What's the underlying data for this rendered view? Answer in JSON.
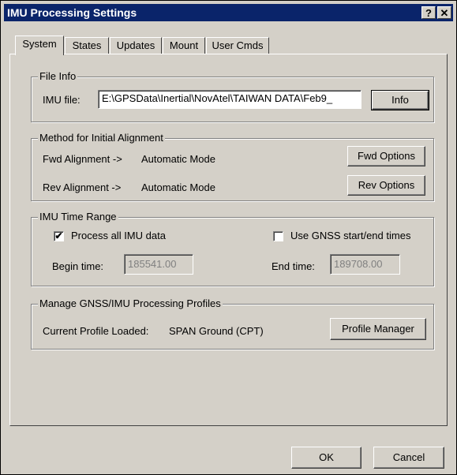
{
  "window": {
    "title": "IMU Processing Settings",
    "help_label": "?",
    "close_label": "✕"
  },
  "tabs": [
    {
      "label": "System",
      "active": true
    },
    {
      "label": "States"
    },
    {
      "label": "Updates"
    },
    {
      "label": "Mount"
    },
    {
      "label": "User Cmds"
    }
  ],
  "file_info": {
    "group_title": "File Info",
    "imu_label": "IMU file:",
    "imu_value": "E:\\GPSData\\Inertial\\NovAtel\\TAIWAN DATA\\Feb9_",
    "info_button": "Info"
  },
  "alignment": {
    "group_title": "Method for Initial Alignment",
    "fwd_label": "Fwd Alignment ->",
    "fwd_mode": "Automatic Mode",
    "fwd_button": "Fwd Options",
    "rev_label": "Rev Alignment ->",
    "rev_mode": "Automatic Mode",
    "rev_button": "Rev Options"
  },
  "time_range": {
    "group_title": "IMU Time Range",
    "process_all_label": "Process all IMU data",
    "process_all_checked": "✔",
    "use_gnss_label": "Use GNSS start/end times",
    "use_gnss_checked": "",
    "begin_label": "Begin time:",
    "begin_value": "185541.00",
    "end_label": "End time:",
    "end_value": "189708.00"
  },
  "profiles": {
    "group_title": "Manage GNSS/IMU Processing Profiles",
    "current_label": "Current Profile Loaded:",
    "current_value": "SPAN Ground (CPT)",
    "manager_button": "Profile Manager"
  },
  "footer": {
    "ok_button": "OK",
    "cancel_button": "Cancel"
  }
}
